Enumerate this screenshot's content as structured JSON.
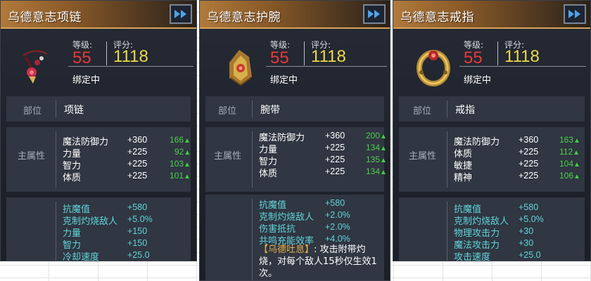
{
  "cards": [
    {
      "title": "乌德意志项链",
      "level_label": "等级:",
      "score_label": "评分:",
      "level": "55",
      "score": "1118",
      "bind": "绑定中",
      "slot_label": "部位",
      "slot": "项链",
      "main_attr_label": "主属性",
      "icon": "necklace-icon",
      "main_stats": [
        {
          "name": "魔法防御力",
          "value": "+360",
          "compare": "166"
        },
        {
          "name": "力量",
          "value": "+225",
          "compare": "92"
        },
        {
          "name": "智力",
          "value": "+225",
          "compare": "103"
        },
        {
          "name": "体质",
          "value": "+225",
          "compare": "101"
        }
      ],
      "sub_stats": [
        {
          "name": "抗魔值",
          "value": "+580"
        },
        {
          "name": "克制灼烧敌人",
          "value": "+5.0%"
        },
        {
          "name": "力量",
          "value": "+150"
        },
        {
          "name": "智力",
          "value": "+150"
        },
        {
          "name": "冷却速度",
          "value": "+25.0"
        }
      ]
    },
    {
      "title": "乌德意志护腕",
      "level_label": "等级:",
      "score_label": "评分:",
      "level": "55",
      "score": "1118",
      "bind": "绑定中",
      "slot_label": "部位",
      "slot": "腕带",
      "main_attr_label": "主属性",
      "icon": "bracer-icon",
      "main_stats": [
        {
          "name": "魔法防御力",
          "value": "+360",
          "compare": "200"
        },
        {
          "name": "力量",
          "value": "+225",
          "compare": "134"
        },
        {
          "name": "智力",
          "value": "+225",
          "compare": "135"
        },
        {
          "name": "体质",
          "value": "+225",
          "compare": "134"
        }
      ],
      "sub_stats": [
        {
          "name": "抗魔值",
          "value": "+580"
        },
        {
          "name": "克制灼烧敌人",
          "value": "+2.0%"
        },
        {
          "name": "伤害抵抗",
          "value": "+2.0%"
        },
        {
          "name": "共鸣充能效率",
          "value": "+4.0%"
        }
      ],
      "skill_name": "【乌德吐息】",
      "skill_desc": ": 攻击附带灼烧，对每个敌人15秒仅生效1次。"
    },
    {
      "title": "乌德意志戒指",
      "level_label": "等级:",
      "score_label": "评分:",
      "level": "55",
      "score": "1118",
      "bind": "绑定中",
      "slot_label": "部位",
      "slot": "戒指",
      "main_attr_label": "主属性",
      "icon": "ring-icon",
      "main_stats": [
        {
          "name": "魔法防御力",
          "value": "+360",
          "compare": "163"
        },
        {
          "name": "体质",
          "value": "+225",
          "compare": "112"
        },
        {
          "name": "敏捷",
          "value": "+225",
          "compare": "104"
        },
        {
          "name": "精神",
          "value": "+225",
          "compare": "106"
        }
      ],
      "sub_stats": [
        {
          "name": "抗魔值",
          "value": "+580"
        },
        {
          "name": "克制灼烧敌人",
          "value": "+5.0%"
        },
        {
          "name": "物理攻击力",
          "value": "+30"
        },
        {
          "name": "魔法攻击力",
          "value": "+30"
        },
        {
          "name": "攻击速度",
          "value": "+25.0"
        }
      ]
    }
  ],
  "colors": {
    "level": "#e8393a",
    "score": "#ecd84a",
    "sub_stat": "#5fd6d9",
    "compare_up": "#4cd04c",
    "skill_name": "#e9b24a",
    "title_gold": "#b07a3c"
  },
  "icons": {
    "expand": "double-arrow-right-icon",
    "compare_up": "up-arrow-icon"
  }
}
